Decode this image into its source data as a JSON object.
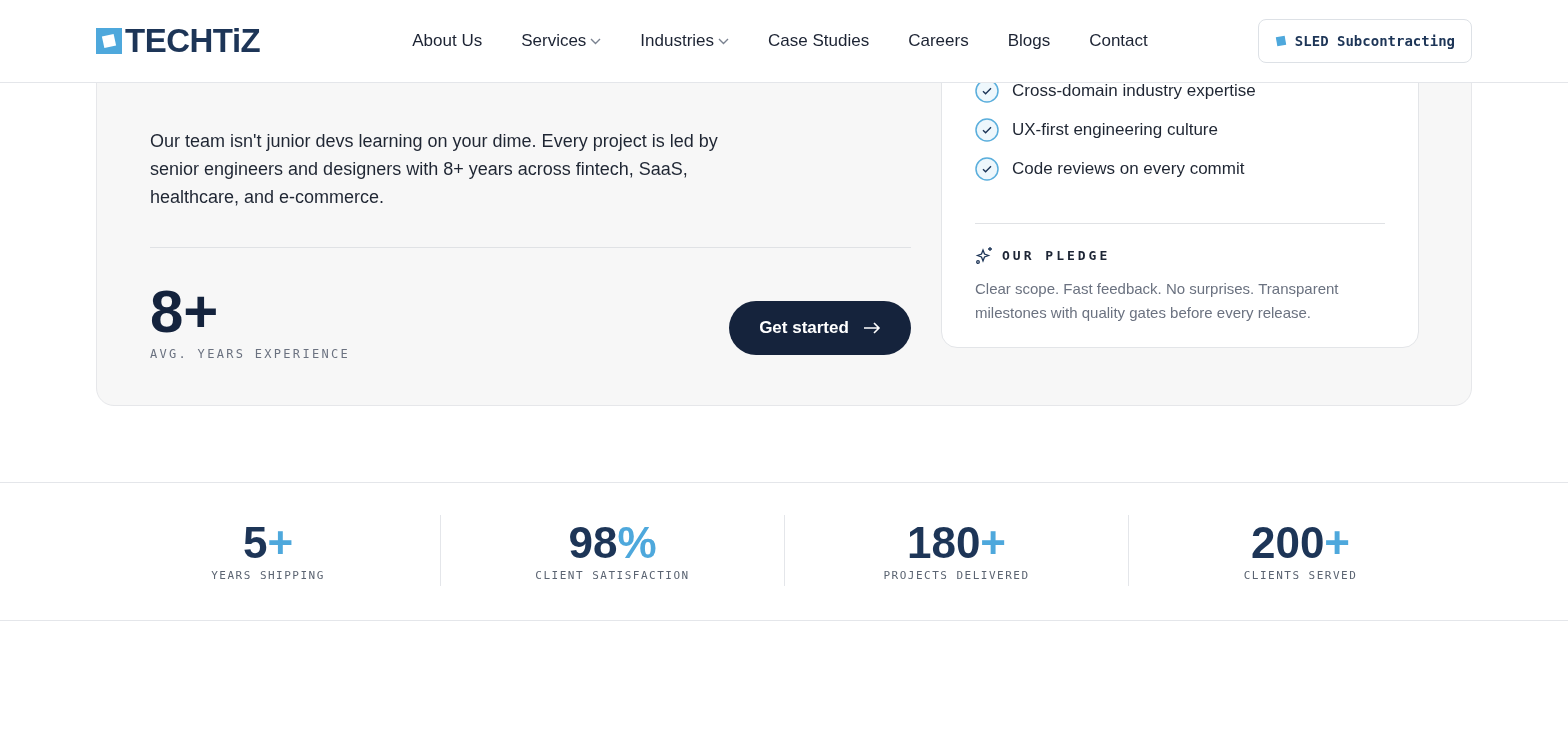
{
  "header": {
    "logo": "TECHTiZ",
    "nav": [
      {
        "label": "About Us",
        "dropdown": false
      },
      {
        "label": "Services",
        "dropdown": true
      },
      {
        "label": "Industries",
        "dropdown": true
      },
      {
        "label": "Case Studies",
        "dropdown": false
      },
      {
        "label": "Careers",
        "dropdown": false
      },
      {
        "label": "Blogs",
        "dropdown": false
      },
      {
        "label": "Contact",
        "dropdown": false
      }
    ],
    "cta": "SLED Subcontracting"
  },
  "team": {
    "description": "Our team isn't junior devs learning on your dime. Every project is led by senior engineers and designers with 8+ years across fintech, SaaS, healthcare, and e-commerce.",
    "stat_value": "8+",
    "stat_label": "AVG. YEARS EXPERIENCE",
    "button": "Get started",
    "checklist": [
      "Cross-domain industry expertise",
      "UX-first engineering culture",
      "Code reviews on every commit"
    ],
    "pledge_title": "OUR PLEDGE",
    "pledge_text": "Clear scope. Fast feedback. No surprises. Transparent milestones with quality gates before every release."
  },
  "stats": [
    {
      "value": "5",
      "suffix": "+",
      "label": "YEARS SHIPPING"
    },
    {
      "value": "98",
      "suffix": "%",
      "label": "CLIENT SATISFACTION"
    },
    {
      "value": "180",
      "suffix": "+",
      "label": "PROJECTS DELIVERED"
    },
    {
      "value": "200",
      "suffix": "+",
      "label": "CLIENTS SERVED"
    }
  ]
}
